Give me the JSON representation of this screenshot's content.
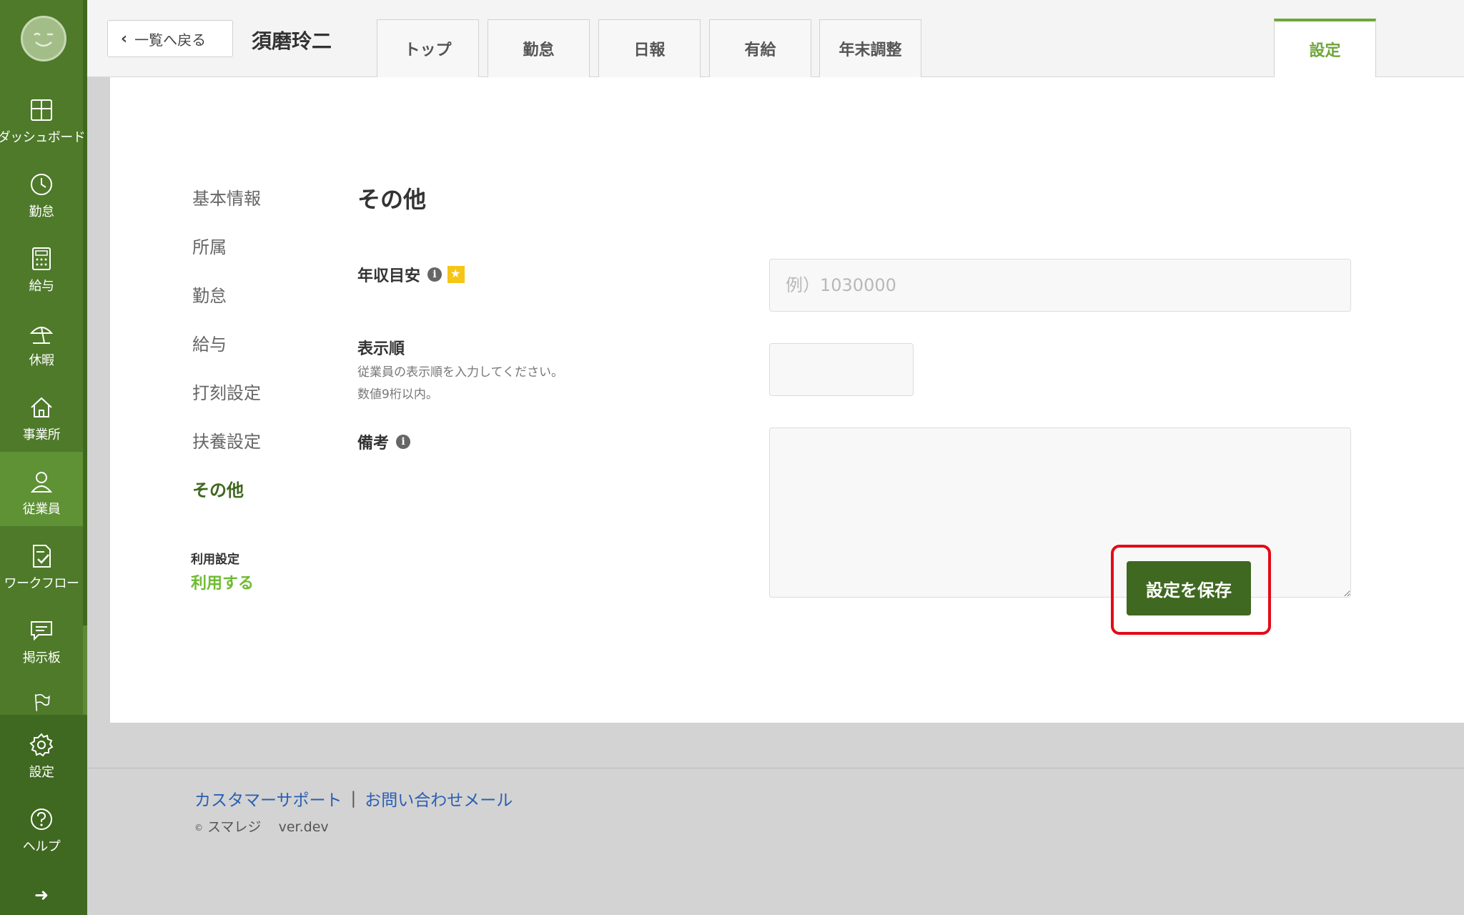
{
  "sidebar": {
    "items": [
      {
        "label": "ダッシュボード"
      },
      {
        "label": "勤怠"
      },
      {
        "label": "給与"
      },
      {
        "label": "休暇"
      },
      {
        "label": "事業所"
      },
      {
        "label": "従業員"
      },
      {
        "label": "ワークフロー"
      },
      {
        "label": "掲示板"
      },
      {
        "label": ""
      },
      {
        "label": "設定"
      },
      {
        "label": "ヘルプ"
      }
    ],
    "active_item": "従業員",
    "expand_arrow": "➜"
  },
  "header": {
    "back_label": "一覧へ戻る",
    "employee_name": "須磨玲二",
    "tabs": [
      {
        "label": "トップ"
      },
      {
        "label": "勤怠"
      },
      {
        "label": "日報"
      },
      {
        "label": "有給"
      },
      {
        "label": "年末調整"
      },
      {
        "label": "設定"
      }
    ],
    "active_tab": "設定"
  },
  "side_menu": {
    "items": [
      {
        "label": "基本情報"
      },
      {
        "label": "所属"
      },
      {
        "label": "勤怠"
      },
      {
        "label": "給与"
      },
      {
        "label": "打刻設定"
      },
      {
        "label": "扶養設定"
      },
      {
        "label": "その他"
      }
    ],
    "active_item": "その他",
    "usage_label": "利用設定",
    "usage_value": "利用する"
  },
  "form": {
    "section_title": "その他",
    "annual_income": {
      "label": "年収目安",
      "placeholder": "例）1030000",
      "value": ""
    },
    "display_order": {
      "label": "表示順",
      "hint_line1": "従業員の表示順を入力してください。",
      "hint_line2": "数値9桁以内。",
      "value": ""
    },
    "remarks": {
      "label": "備考",
      "value": ""
    },
    "save_label": "設定を保存"
  },
  "footer": {
    "support_link": "カスタマーサポート",
    "separator": "|",
    "contact_link": "お問い合わせメール",
    "copyright_symbol": "©",
    "company": "スマレジ",
    "version": "ver.dev"
  },
  "colors": {
    "sidebar": "#4e7a2a",
    "accent": "#6fa63a",
    "primary_button": "#3f6820",
    "highlight": "#e30b17",
    "link": "#2a5fb0"
  }
}
